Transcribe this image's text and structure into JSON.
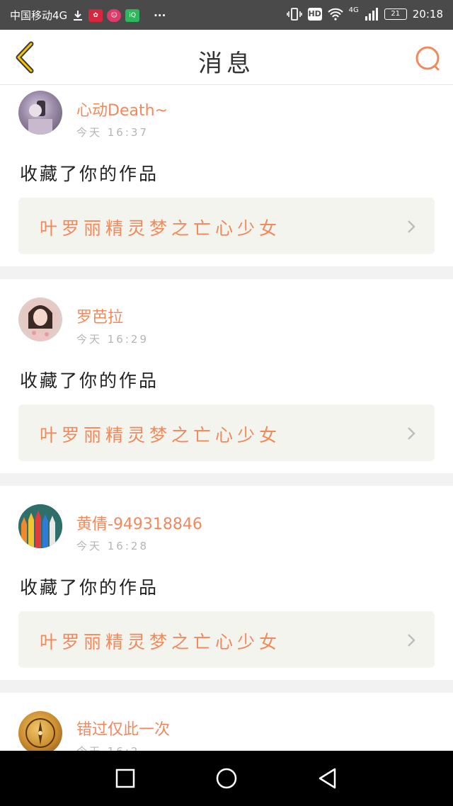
{
  "status_bar": {
    "carrier": "中国移动4G",
    "icons": [
      "download-icon",
      "huawei-icon",
      "app-icon",
      "iqiyi-icon",
      "more-icon"
    ],
    "more": "···",
    "right_icons": [
      "vibrate-icon",
      "hd-icon",
      "wifi-icon",
      "signal-icon",
      "battery-icon"
    ],
    "hd": "HD",
    "network": "4G",
    "battery": "21",
    "time": "20:18"
  },
  "header": {
    "title": "消息",
    "accent": "#f08a5d"
  },
  "notifications": [
    {
      "username": "心动Death~",
      "time": "今天 16:37",
      "action": "收藏了你的作品",
      "work_title": "叶罗丽精灵梦之亡心少女"
    },
    {
      "username": "罗芭拉",
      "time": "今天 16:29",
      "action": "收藏了你的作品",
      "work_title": "叶罗丽精灵梦之亡心少女"
    },
    {
      "username": "黄倩-949318846",
      "time": "今天 16:28",
      "action": "收藏了你的作品",
      "work_title": "叶罗丽精灵梦之亡心少女"
    },
    {
      "username": "错过仅此一次",
      "time": "今天 16:2",
      "action": "",
      "work_title": ""
    }
  ],
  "nav": {
    "buttons": [
      "recent-apps-icon",
      "home-icon",
      "back-triangle-icon"
    ]
  }
}
